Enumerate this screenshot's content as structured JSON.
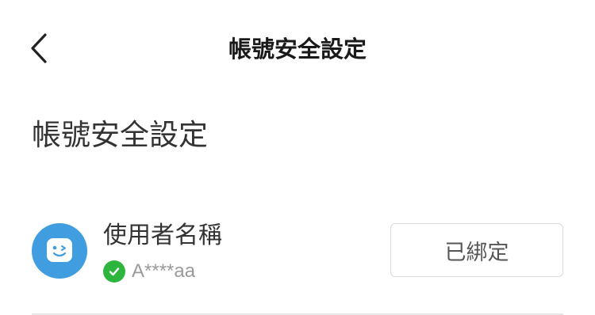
{
  "nav": {
    "title": "帳號安全設定",
    "back_icon": "chevron-left-icon"
  },
  "section": {
    "title": "帳號安全設定"
  },
  "account_items": [
    {
      "icon": "smiley-avatar-icon",
      "icon_color": "#3f9de0",
      "label": "使用者名稱",
      "status_icon": "check-circle-icon",
      "status_color": "#2eb53e",
      "value": "A****aa",
      "button_label": "已綁定"
    }
  ]
}
